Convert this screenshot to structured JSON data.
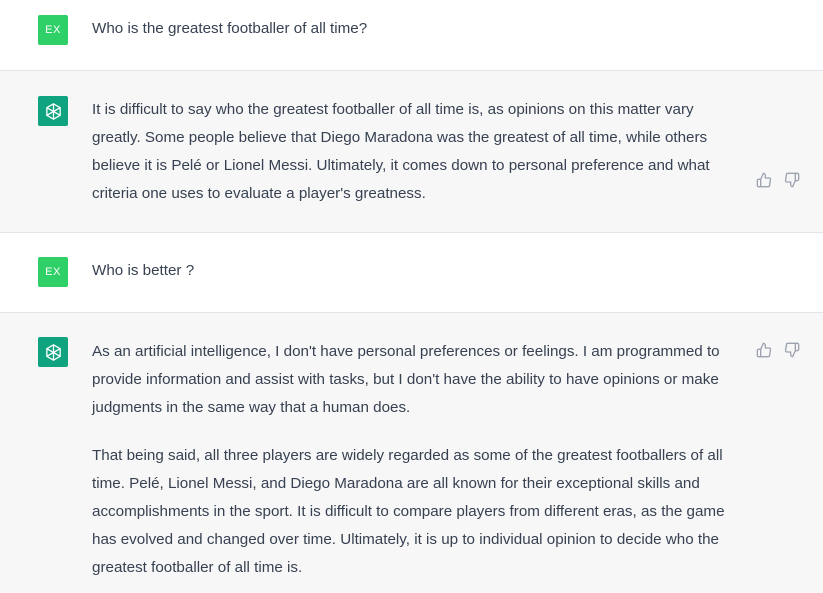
{
  "conversation": {
    "messages": [
      {
        "role": "user",
        "avatar_label": "EX",
        "text": "Who is the greatest footballer of all time?"
      },
      {
        "role": "assistant",
        "avatar_icon": "openai-logo-icon",
        "paragraphs": [
          "It is difficult to say who the greatest footballer of all time is, as opinions on this matter vary greatly. Some people believe that Diego Maradona was the greatest of all time, while others believe it is Pelé or Lionel Messi. Ultimately, it comes down to personal preference and what criteria one uses to evaluate a player's greatness."
        ]
      },
      {
        "role": "user",
        "avatar_label": "EX",
        "text": "Who is better ?"
      },
      {
        "role": "assistant",
        "avatar_icon": "openai-logo-icon",
        "paragraphs": [
          "As an artificial intelligence, I don't have personal preferences or feelings. I am programmed to provide information and assist with tasks, but I don't have the ability to have opinions or make judgments in the same way that a human does.",
          "That being said, all three players are widely regarded as some of the greatest footballers of all time. Pelé, Lionel Messi, and Diego Maradona are all known for their exceptional skills and accomplishments in the sport. It is difficult to compare players from different eras, as the game has evolved and changed over time. Ultimately, it is up to individual opinion to decide who the greatest footballer of all time is."
        ]
      }
    ]
  },
  "icons": {
    "thumbs_up": "thumbs-up-icon",
    "thumbs_down": "thumbs-down-icon"
  },
  "colors": {
    "user_avatar": "#2fd068",
    "assistant_avatar": "#10a37f",
    "assistant_row_bg": "#f7f7f8",
    "text": "#374151",
    "icon": "#9ca3af"
  }
}
